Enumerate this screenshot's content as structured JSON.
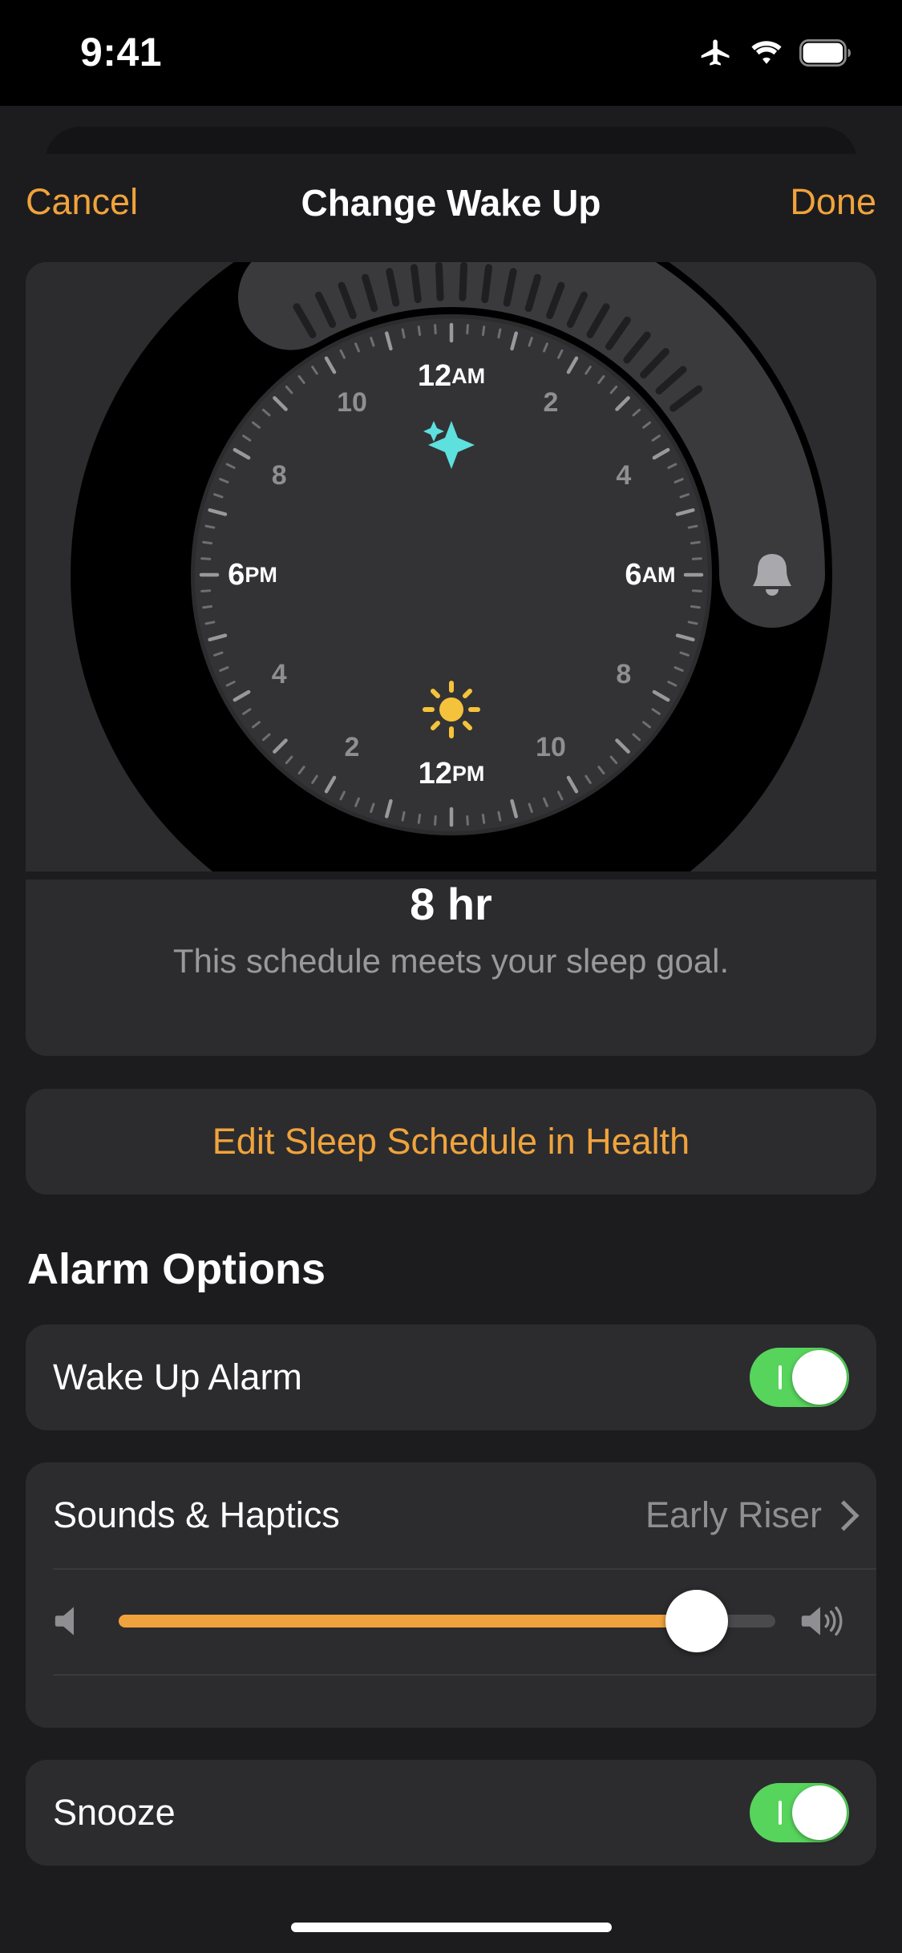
{
  "status_bar": {
    "time": "9:41",
    "icons": [
      "airplane-mode-icon",
      "wifi-icon",
      "battery-icon"
    ]
  },
  "nav": {
    "cancel_label": "Cancel",
    "title": "Change Wake Up",
    "done_label": "Done"
  },
  "dial": {
    "major_labels": [
      {
        "text": "12",
        "suffix": "AM",
        "hour": 0
      },
      {
        "text": "6",
        "suffix": "AM",
        "hour": 6
      },
      {
        "text": "12",
        "suffix": "PM",
        "hour": 12
      },
      {
        "text": "6",
        "suffix": "PM",
        "hour": 18
      }
    ],
    "minor_labels": [
      {
        "text": "2",
        "hour": 2
      },
      {
        "text": "4",
        "hour": 4
      },
      {
        "text": "8",
        "hour": 8
      },
      {
        "text": "10",
        "hour": 10
      },
      {
        "text": "2",
        "hour": 14
      },
      {
        "text": "4",
        "hour": 16
      },
      {
        "text": "8",
        "hour": 20
      },
      {
        "text": "10",
        "hour": 22
      }
    ],
    "bedtime_icon": "sparkles-icon",
    "bedtime_icon_color": "#5ee0de",
    "daytime_icon": "sun-icon",
    "daytime_icon_color": "#f5c33b",
    "wake_handle_icon": "bell-icon",
    "sleep_start_hour": 22,
    "sleep_end_hour": 6,
    "track_color": "#000000",
    "segment_color": "#3a3a3c"
  },
  "duration": {
    "value": "8 hr",
    "note": "This schedule meets your sleep goal."
  },
  "edit_health": {
    "label": "Edit Sleep Schedule in Health"
  },
  "alarm_options": {
    "header": "Alarm Options",
    "rows": [
      {
        "label": "Wake Up Alarm",
        "type": "toggle",
        "value": "on"
      },
      {
        "label": "Sounds & Haptics",
        "type": "disclosure",
        "value": "Early Riser"
      },
      {
        "label": "Snooze",
        "type": "toggle",
        "value": "on"
      }
    ],
    "volume": {
      "percent": 88,
      "min_icon": "speaker-low-icon",
      "max_icon": "speaker-high-icon",
      "fill_color": "#f0a33c"
    }
  },
  "colors": {
    "accent": "#f0a33c",
    "toggle_on": "#57d45c",
    "card": "#2c2c2e",
    "background": "#1c1c1e",
    "secondary_text": "#8e8e93"
  }
}
